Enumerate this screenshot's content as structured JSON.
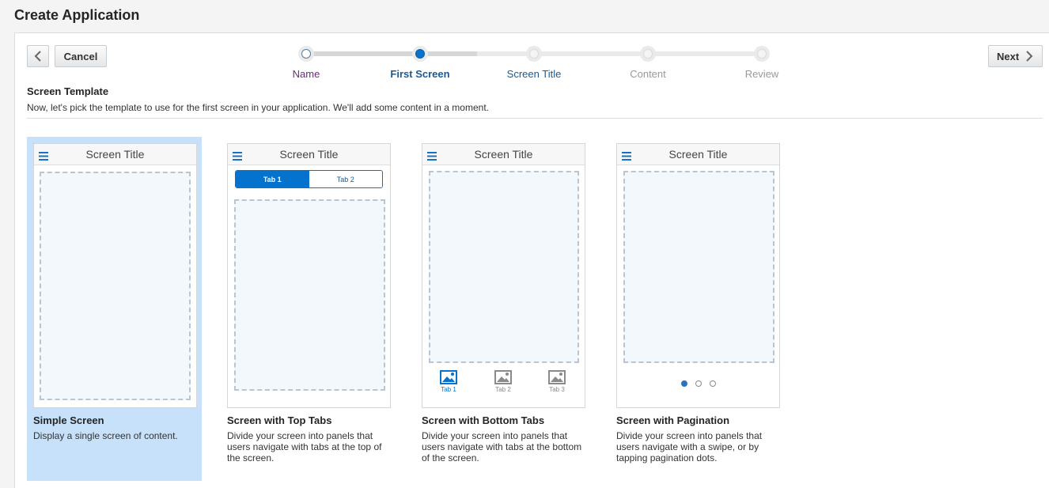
{
  "page": {
    "title": "Create Application"
  },
  "toolbar": {
    "cancel_label": "Cancel",
    "next_label": "Next"
  },
  "train": {
    "steps": [
      {
        "label": "Name",
        "state": "visited"
      },
      {
        "label": "First Screen",
        "state": "current"
      },
      {
        "label": "Screen Title",
        "state": "next"
      },
      {
        "label": "Content",
        "state": "disabled"
      },
      {
        "label": "Review",
        "state": "disabled"
      }
    ]
  },
  "section": {
    "title": "Screen Template",
    "description": "Now, let's pick the template to use for the first screen in your application. We'll add some content in a moment."
  },
  "templates": [
    {
      "name": "Simple Screen",
      "description": "Display a single screen of content.",
      "screen_title": "Screen Title",
      "selected": true
    },
    {
      "name": "Screen with Top Tabs",
      "description": "Divide your screen into panels that users navigate with tabs at the top of the screen.",
      "screen_title": "Screen Title",
      "tabs": [
        "Tab 1",
        "Tab 2"
      ]
    },
    {
      "name": "Screen with Bottom Tabs",
      "description": "Divide your screen into panels that users navigate with tabs at the bottom of the screen.",
      "screen_title": "Screen Title",
      "tabs": [
        "Tab 1",
        "Tab 2",
        "Tab 3"
      ]
    },
    {
      "name": "Screen with Pagination",
      "description": "Divide your screen into panels that users navigate with a swipe, or by tapping pagination dots.",
      "screen_title": "Screen Title"
    }
  ],
  "colors": {
    "accent": "#0572ce",
    "selected_bg": "#c6e1f9",
    "visited": "#6d2a7e"
  }
}
